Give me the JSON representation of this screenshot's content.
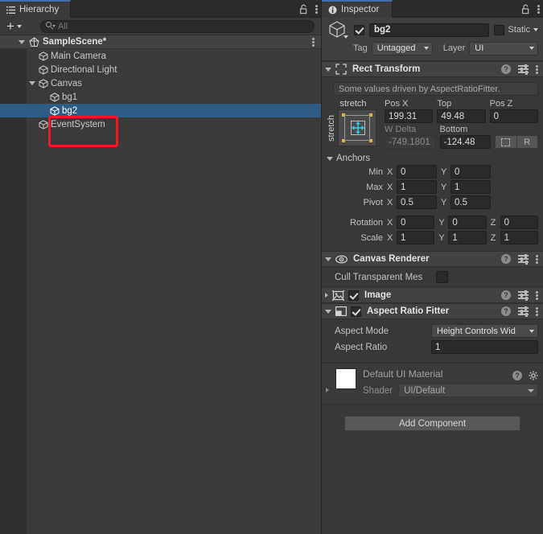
{
  "hierarchy": {
    "tab_label": "Hierarchy",
    "tab_icon": "hierarchy-list-icon",
    "lock_icon": "lock-open-icon",
    "menu_icon": "kebab-menu-icon",
    "toolbar": {
      "add_label": "+",
      "search_placeholder": "All",
      "search_icon": "search-icon"
    },
    "scene": {
      "name": "SampleScene*",
      "icon": "unity-scene-icon"
    },
    "items": [
      {
        "name": "Main Camera",
        "depth": 2,
        "expandable": false,
        "selected": false
      },
      {
        "name": "Directional Light",
        "depth": 2,
        "expandable": false,
        "selected": false
      },
      {
        "name": "Canvas",
        "depth": 2,
        "expandable": true,
        "expanded": true,
        "selected": false
      },
      {
        "name": "bg1",
        "depth": 3,
        "expandable": false,
        "selected": false
      },
      {
        "name": "bg2",
        "depth": 3,
        "expandable": false,
        "selected": true
      },
      {
        "name": "EventSystem",
        "depth": 2,
        "expandable": false,
        "selected": false
      }
    ],
    "annotation": {
      "shape": "rectangle",
      "color": "#ee1b24",
      "targets": "bg1 and bg2"
    }
  },
  "inspector": {
    "tab_label": "Inspector",
    "tab_icon": "info-circle-icon",
    "lock_icon": "lock-open-icon",
    "menu_icon": "kebab-menu-icon",
    "game_object": {
      "icon": "gameobject-cube-icon",
      "enabled": true,
      "name": "bg2",
      "static_label": "Static",
      "static_checked": false,
      "tag_label": "Tag",
      "tag_value": "Untagged",
      "layer_label": "Layer",
      "layer_value": "UI"
    },
    "rect_transform": {
      "title": "Rect Transform",
      "icon": "rect-transform-icon",
      "expanded": true,
      "help_icon": "help-icon",
      "preset_icon": "preset-sliders-icon",
      "menu_icon": "kebab-menu-icon",
      "driven_notice": "Some values driven by AspectRatioFitter.",
      "anchor_preset": {
        "top_label": "stretch",
        "left_label": "stretch"
      },
      "row1": [
        {
          "label": "Pos X",
          "value": "199.31",
          "dim": false
        },
        {
          "label": "Top",
          "value": "49.48",
          "dim": false
        },
        {
          "label": "Pos Z",
          "value": "0",
          "dim": false
        }
      ],
      "row2": [
        {
          "label": "W Delta",
          "value": "-749.1801",
          "dim": true
        },
        {
          "label": "Bottom",
          "value": "-124.48",
          "dim": false
        }
      ],
      "blueprint_button": "blueprint-mode-icon",
      "raw_button": "R",
      "anchors_label": "Anchors",
      "anchor_rows": [
        {
          "label": "Min",
          "x": "0",
          "y": "0"
        },
        {
          "label": "Max",
          "x": "1",
          "y": "1"
        },
        {
          "label": "Pivot",
          "x": "0.5",
          "y": "0.5"
        }
      ],
      "rotation": {
        "label": "Rotation",
        "x": "0",
        "y": "0",
        "z": "0"
      },
      "scale": {
        "label": "Scale",
        "x": "1",
        "y": "1",
        "z": "1"
      }
    },
    "components": [
      {
        "title": "Canvas Renderer",
        "icon": "eye-icon",
        "expanded": true,
        "has_toggle": false,
        "rows": [
          {
            "label": "Cull Transparent Mes",
            "type": "checkbox",
            "checked": false
          }
        ]
      },
      {
        "title": "Image",
        "icon": "image-component-icon",
        "expanded": false,
        "has_toggle": true,
        "enabled": true,
        "rows": []
      },
      {
        "title": "Aspect Ratio Fitter",
        "icon": "aspect-ratio-fitter-icon",
        "expanded": true,
        "has_toggle": true,
        "enabled": true,
        "rows": [
          {
            "label": "Aspect Mode",
            "type": "dropdown",
            "value": "Height Controls Wid"
          },
          {
            "label": "Aspect Ratio",
            "type": "text",
            "value": "1"
          }
        ]
      }
    ],
    "material": {
      "name": "Default UI Material",
      "swatch_color": "#ffffff",
      "shader_label": "Shader",
      "shader_value": "UI/Default",
      "help_icon": "help-icon",
      "settings_icon": "gear-icon"
    },
    "add_component_label": "Add Component"
  },
  "theme": {
    "panel_bg": "#383838",
    "header_bg": "#424242",
    "field_bg": "#2a2a2a",
    "selection_blue": "#2d5c87",
    "tab_accent": "#3f6fa6",
    "annotation_red": "#ee1b24"
  }
}
